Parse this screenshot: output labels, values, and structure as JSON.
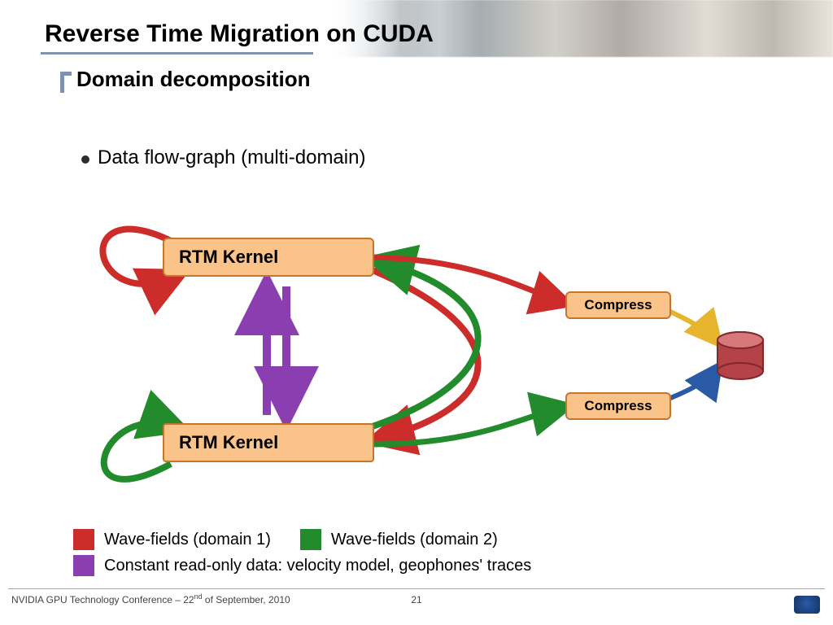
{
  "header": {
    "title": "Reverse Time Migration on CUDA",
    "subtitle": "Domain decomposition"
  },
  "bullet": {
    "text": "Data flow-graph (multi-domain)"
  },
  "boxes": {
    "kernel1": "RTM Kernel",
    "kernel2": "RTM Kernel",
    "compress1": "Compress",
    "compress2": "Compress"
  },
  "legend": {
    "domain1": "Wave-fields (domain 1)",
    "domain2": "Wave-fields (domain 2)",
    "readonly": "Constant read-only data: velocity model, geophones' traces"
  },
  "footer": {
    "left_prefix": "NVIDIA GPU Technology Conference – 22",
    "left_ord": "nd",
    "left_suffix": " of September, 2010",
    "page": "21"
  },
  "colors": {
    "red": "#cc2d2a",
    "green": "#228b2b",
    "purple": "#8a3eb0",
    "yellow": "#e6b52d",
    "blue": "#2a5aa6",
    "box_fill": "#f9c38a",
    "box_stroke": "#c8752c",
    "title_accent": "#7e94ac",
    "db_fill": "#b44246"
  }
}
